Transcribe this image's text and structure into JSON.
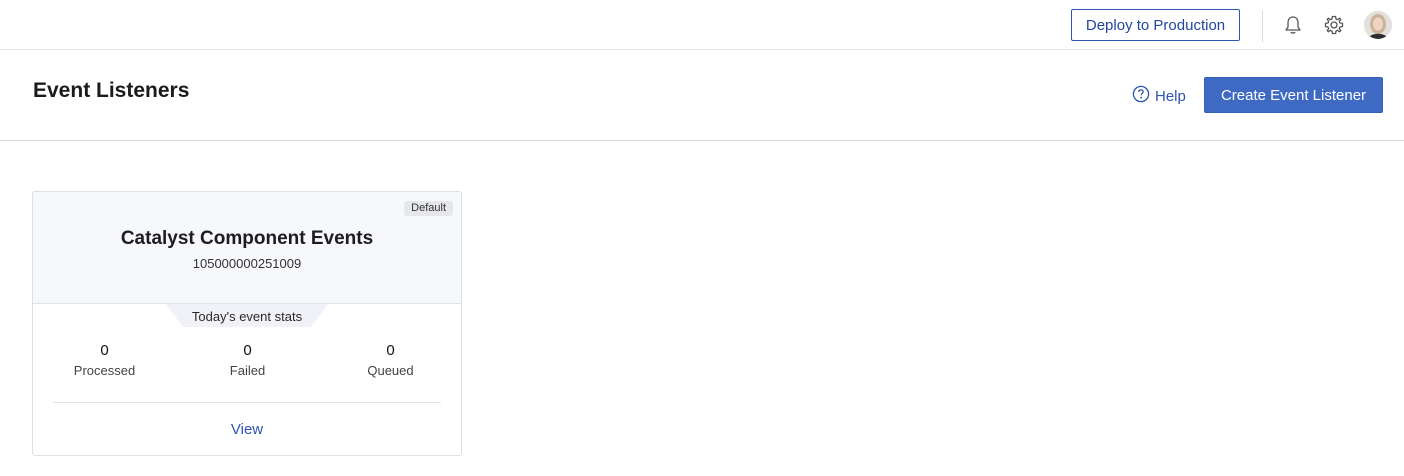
{
  "topbar": {
    "deploy_label": "Deploy to Production",
    "icons": [
      "bell-icon",
      "gear-icon",
      "user-avatar"
    ]
  },
  "header": {
    "title": "Event Listeners",
    "help_label": "Help",
    "create_label": "Create Event Listener"
  },
  "card": {
    "badge": "Default",
    "title": "Catalyst Component Events",
    "id": "105000000251009",
    "stats_label": "Today's event stats",
    "stats": [
      {
        "value": "0",
        "label": "Processed"
      },
      {
        "value": "0",
        "label": "Failed"
      },
      {
        "value": "0",
        "label": "Queued"
      }
    ],
    "view_label": "View"
  },
  "colors": {
    "accent": "#3f6ac4",
    "link": "#2c54b0",
    "card_header_bg": "#f7f8fc"
  }
}
